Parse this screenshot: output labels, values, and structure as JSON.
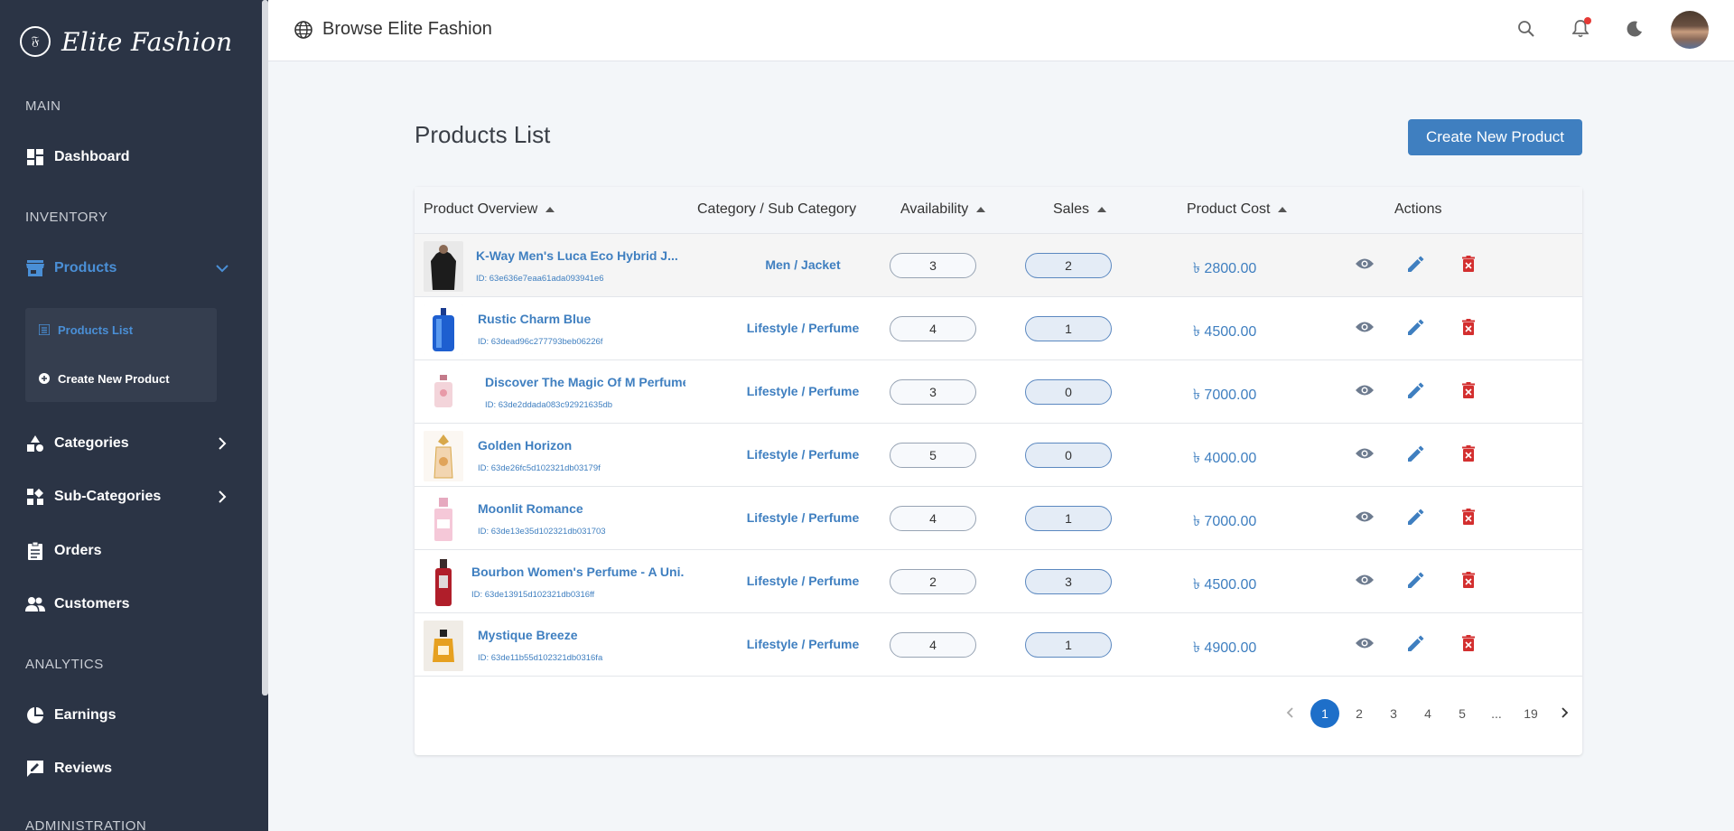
{
  "brand": {
    "name": "Elite Fashion",
    "logo_glyph": "𝔉"
  },
  "sidebar": {
    "sections": {
      "main": "MAIN",
      "inventory": "INVENTORY",
      "analytics": "ANALYTICS",
      "administration": "ADMINISTRATION"
    },
    "items": {
      "dashboard": "Dashboard",
      "products": "Products",
      "categories": "Categories",
      "subcategories": "Sub-Categories",
      "orders": "Orders",
      "customers": "Customers",
      "earnings": "Earnings",
      "reviews": "Reviews"
    },
    "submenu": {
      "products_list": "Products List",
      "create_new_product": "Create New Product"
    }
  },
  "topbar": {
    "title": "Browse Elite Fashion"
  },
  "main": {
    "page_title": "Products List",
    "create_button": "Create New Product"
  },
  "table": {
    "columns": {
      "overview": "Product Overview",
      "category": "Category / Sub Category",
      "availability": "Availability",
      "sales": "Sales",
      "cost": "Product Cost",
      "actions": "Actions"
    },
    "rows": [
      {
        "name": "K-Way Men's Luca Eco Hybrid J...",
        "id": "ID: 63e636e7eaa61ada093941e6",
        "category": "Men / Jacket",
        "availability": "3",
        "sales": "2",
        "cost": "৳ 2800.00"
      },
      {
        "name": "Rustic Charm Blue",
        "id": "ID: 63dead96c277793beb06226f",
        "category": "Lifestyle / Perfume",
        "availability": "4",
        "sales": "1",
        "cost": "৳ 4500.00"
      },
      {
        "name": "Discover The Magic Of M Perfume",
        "id": "ID: 63de2ddada083c92921635db",
        "category": "Lifestyle / Perfume",
        "availability": "3",
        "sales": "0",
        "cost": "৳ 7000.00"
      },
      {
        "name": "Golden Horizon",
        "id": "ID: 63de26fc5d102321db03179f",
        "category": "Lifestyle / Perfume",
        "availability": "5",
        "sales": "0",
        "cost": "৳ 4000.00"
      },
      {
        "name": "Moonlit Romance",
        "id": "ID: 63de13e35d102321db031703",
        "category": "Lifestyle / Perfume",
        "availability": "4",
        "sales": "1",
        "cost": "৳ 7000.00"
      },
      {
        "name": "Bourbon Women's Perfume - A Uni...",
        "id": "ID: 63de13915d102321db0316ff",
        "category": "Lifestyle / Perfume",
        "availability": "2",
        "sales": "3",
        "cost": "৳ 4500.00"
      },
      {
        "name": "Mystique Breeze",
        "id": "ID: 63de11b55d102321db0316fa",
        "category": "Lifestyle / Perfume",
        "availability": "4",
        "sales": "1",
        "cost": "৳ 4900.00"
      }
    ]
  },
  "pagination": {
    "pages": [
      "1",
      "2",
      "3",
      "4",
      "5",
      "...",
      "19"
    ],
    "current": "1"
  },
  "colors": {
    "sidebar_bg": "#2b3445",
    "accent": "#3f7fc0",
    "active_page": "#1e6fc9",
    "delete": "#d32f2f"
  }
}
